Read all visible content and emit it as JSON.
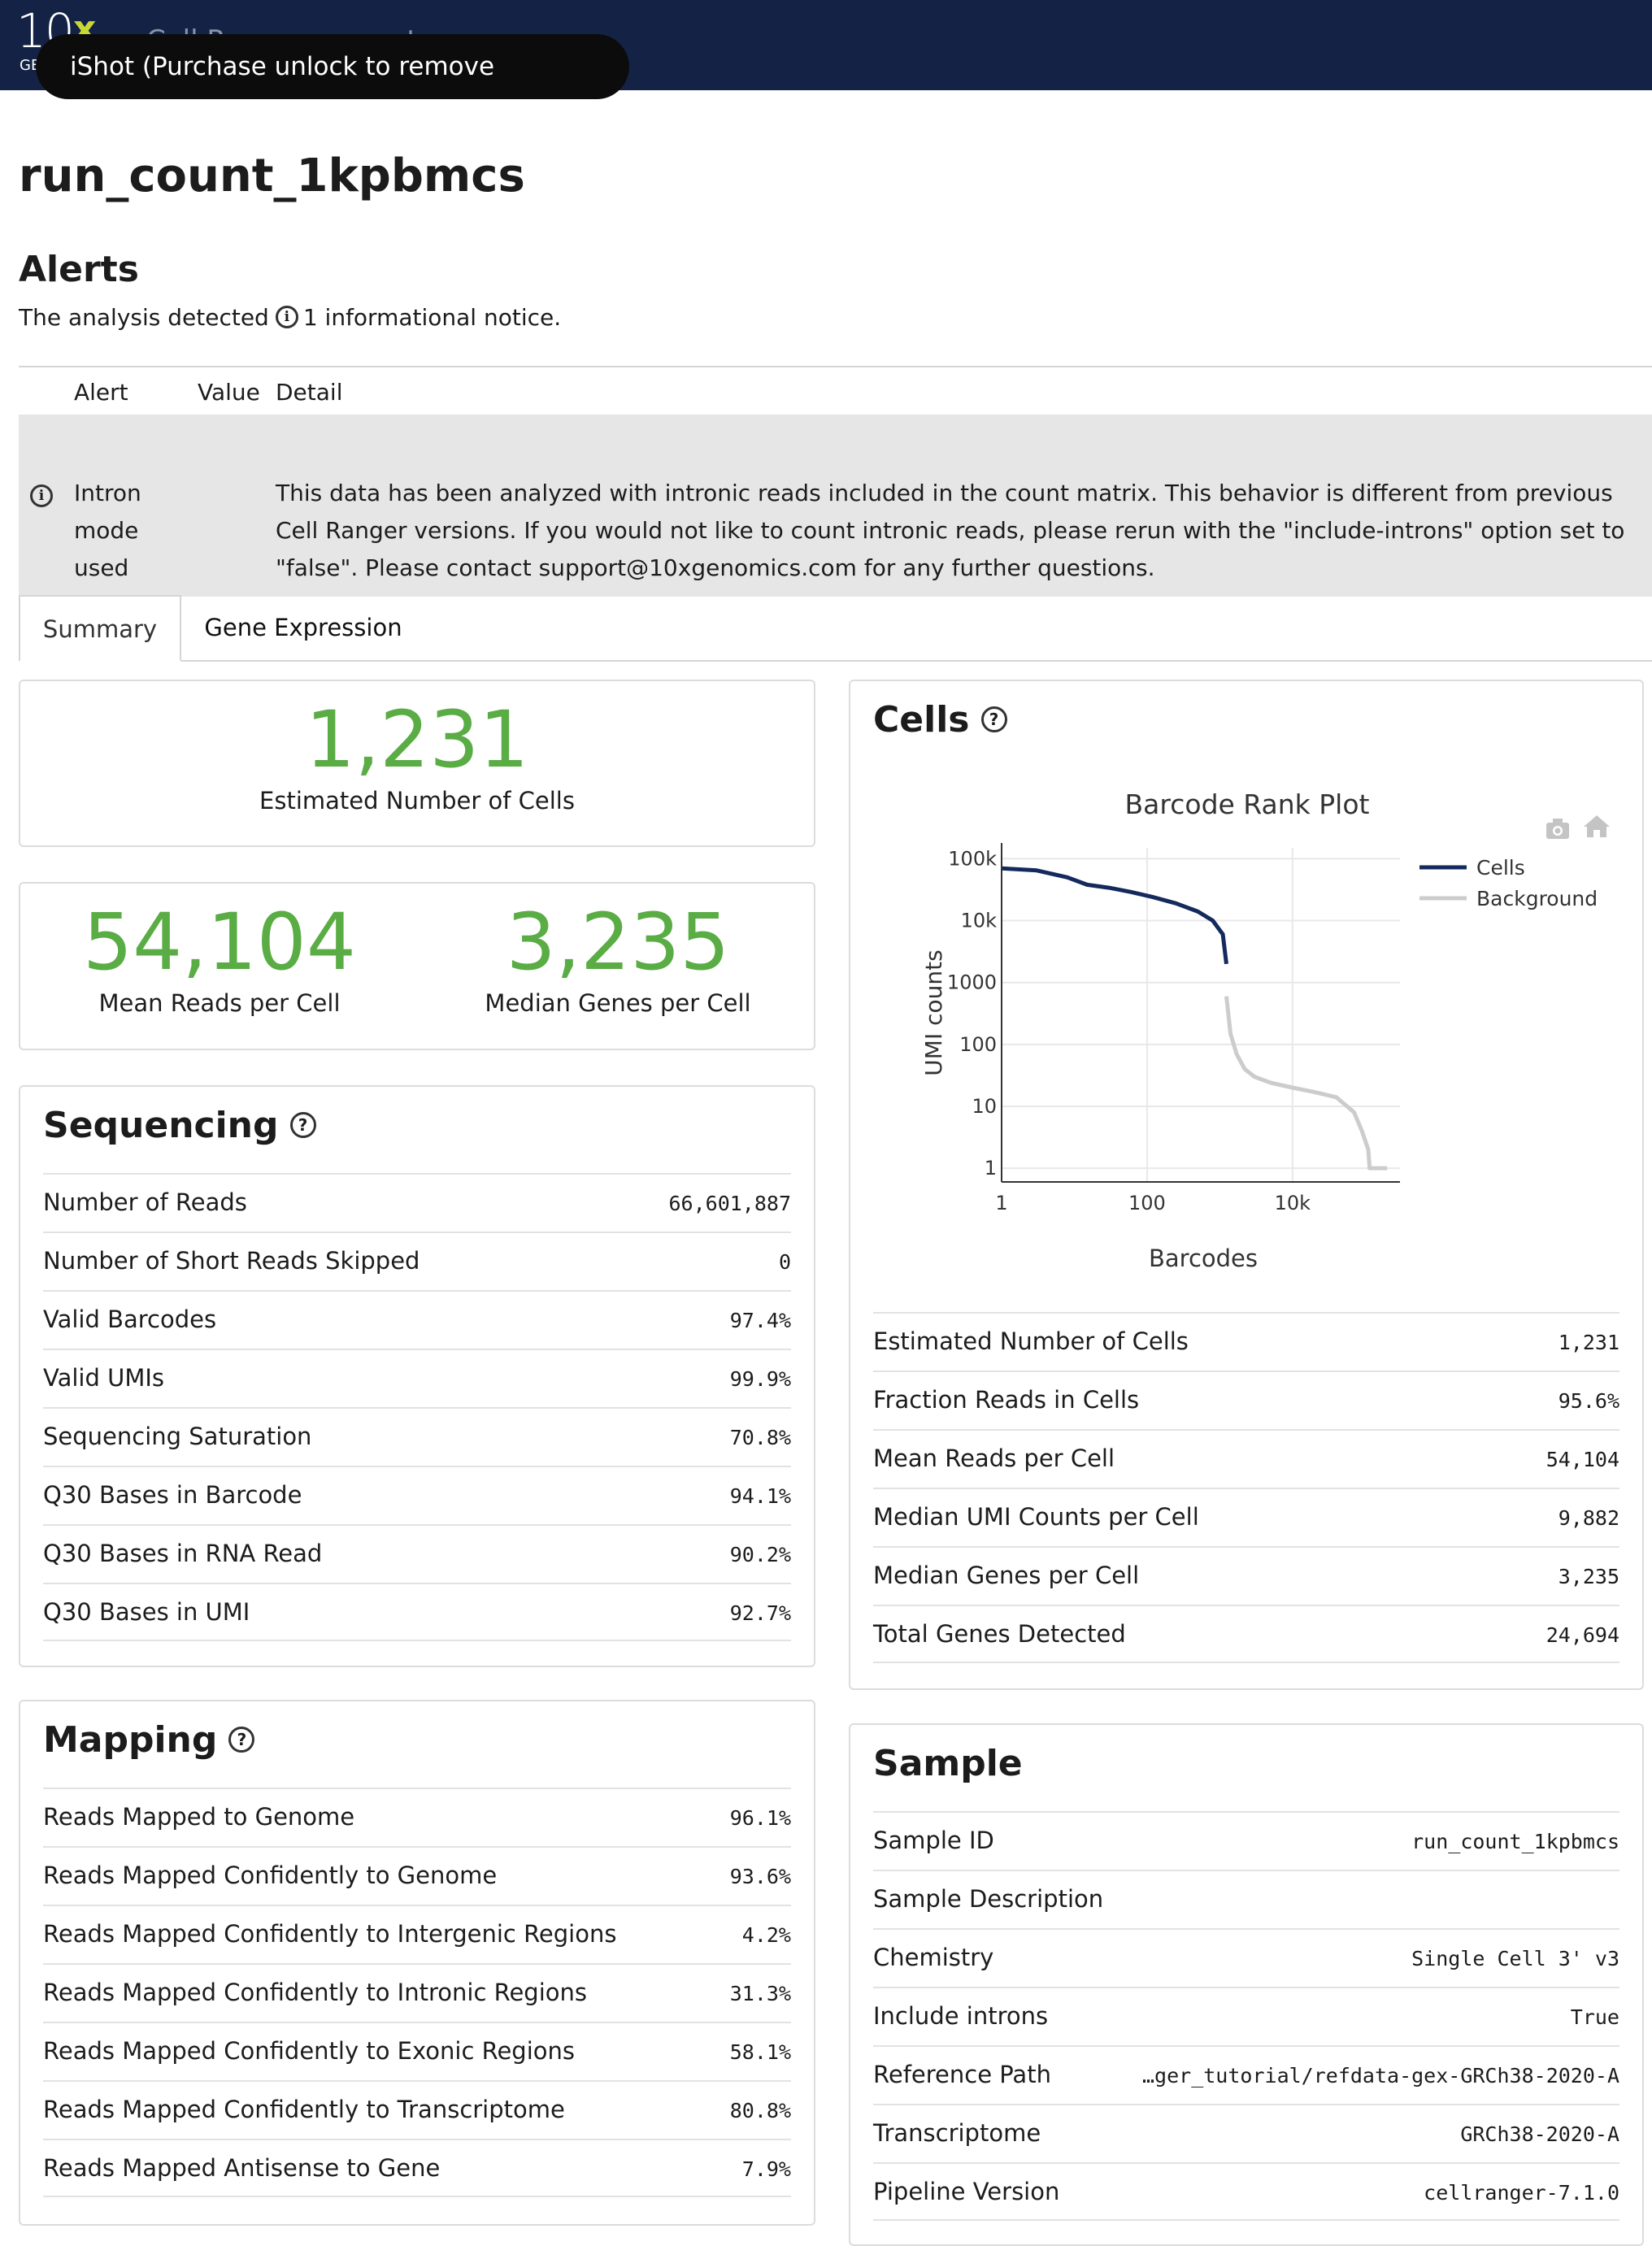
{
  "header": {
    "logo_main": "10",
    "logo_x": "x",
    "logo_sub": "GE",
    "app_title": "Cell Ranger • count",
    "watermark": "iShot (Purchase unlock to remove watermark)"
  },
  "run_title": "run_count_1kpbmcs",
  "alerts": {
    "heading": "Alerts",
    "summary_prefix": "The analysis detected",
    "summary_suffix": "1 informational notice.",
    "columns": [
      "Alert",
      "Value",
      "Detail"
    ],
    "rows": [
      {
        "icon": "info-icon",
        "alert": "Intron mode used",
        "value": "",
        "detail": "This data has been analyzed with intronic reads included in the count matrix. This behavior is different from previous Cell Ranger versions. If you would not like to count intronic reads, please rerun with the \"include-introns\" option set to \"false\". Please contact support@10xgenomics.com for any further questions."
      }
    ]
  },
  "tabs": [
    {
      "label": "Summary",
      "active": true
    },
    {
      "label": "Gene Expression",
      "active": false
    }
  ],
  "hero": {
    "cells_value": "1,231",
    "cells_label": "Estimated Number of Cells",
    "mean_reads_value": "54,104",
    "mean_reads_label": "Mean Reads per Cell",
    "median_genes_value": "3,235",
    "median_genes_label": "Median Genes per Cell",
    "accent_color": "#5aac44"
  },
  "sequencing": {
    "heading": "Sequencing",
    "rows": [
      {
        "label": "Number of Reads",
        "value": "66,601,887"
      },
      {
        "label": "Number of Short Reads Skipped",
        "value": "0"
      },
      {
        "label": "Valid Barcodes",
        "value": "97.4%"
      },
      {
        "label": "Valid UMIs",
        "value": "99.9%"
      },
      {
        "label": "Sequencing Saturation",
        "value": "70.8%"
      },
      {
        "label": "Q30 Bases in Barcode",
        "value": "94.1%"
      },
      {
        "label": "Q30 Bases in RNA Read",
        "value": "90.2%"
      },
      {
        "label": "Q30 Bases in UMI",
        "value": "92.7%"
      }
    ]
  },
  "mapping": {
    "heading": "Mapping",
    "rows": [
      {
        "label": "Reads Mapped to Genome",
        "value": "96.1%"
      },
      {
        "label": "Reads Mapped Confidently to Genome",
        "value": "93.6%"
      },
      {
        "label": "Reads Mapped Confidently to Intergenic Regions",
        "value": "4.2%"
      },
      {
        "label": "Reads Mapped Confidently to Intronic Regions",
        "value": "31.3%"
      },
      {
        "label": "Reads Mapped Confidently to Exonic Regions",
        "value": "58.1%"
      },
      {
        "label": "Reads Mapped Confidently to Transcriptome",
        "value": "80.8%"
      },
      {
        "label": "Reads Mapped Antisense to Gene",
        "value": "7.9%"
      }
    ]
  },
  "cells": {
    "heading": "Cells",
    "rows": [
      {
        "label": "Estimated Number of Cells",
        "value": "1,231"
      },
      {
        "label": "Fraction Reads in Cells",
        "value": "95.6%"
      },
      {
        "label": "Mean Reads per Cell",
        "value": "54,104"
      },
      {
        "label": "Median UMI Counts per Cell",
        "value": "9,882"
      },
      {
        "label": "Median Genes per Cell",
        "value": "3,235"
      },
      {
        "label": "Total Genes Detected",
        "value": "24,694"
      }
    ]
  },
  "sample": {
    "heading": "Sample",
    "rows": [
      {
        "label": "Sample ID",
        "value": "run_count_1kpbmcs"
      },
      {
        "label": "Sample Description",
        "value": ""
      },
      {
        "label": "Chemistry",
        "value": "Single Cell 3' v3"
      },
      {
        "label": "Include introns",
        "value": "True"
      },
      {
        "label": "Reference Path",
        "value": "…ger_tutorial/refdata-gex-GRCh38-2020-A"
      },
      {
        "label": "Transcriptome",
        "value": "GRCh38-2020-A"
      },
      {
        "label": "Pipeline Version",
        "value": "cellranger-7.1.0"
      }
    ]
  },
  "chart_data": {
    "type": "line",
    "title": "Barcode Rank Plot",
    "xlabel": "Barcodes",
    "ylabel": "UMI counts",
    "x_scale": "log",
    "y_scale": "log",
    "xlim": [
      1,
      300000
    ],
    "ylim": [
      0.6,
      150000
    ],
    "x_ticks": [
      {
        "value": 1,
        "label": "1"
      },
      {
        "value": 100,
        "label": "100"
      },
      {
        "value": 10000,
        "label": "10k"
      }
    ],
    "y_ticks": [
      {
        "value": 1,
        "label": "1"
      },
      {
        "value": 10,
        "label": "10"
      },
      {
        "value": 100,
        "label": "100"
      },
      {
        "value": 1000,
        "label": "1000"
      },
      {
        "value": 10000,
        "label": "10k"
      },
      {
        "value": 100000,
        "label": "100k"
      }
    ],
    "grid": true,
    "legend_position": "top-right",
    "series": [
      {
        "name": "Cells",
        "color": "#142a5c",
        "x": [
          1,
          3,
          8,
          15,
          30,
          60,
          120,
          250,
          500,
          800,
          1100,
          1231
        ],
        "y": [
          70000,
          65000,
          50000,
          38000,
          34000,
          29000,
          24000,
          19000,
          14000,
          10000,
          6000,
          2000
        ]
      },
      {
        "name": "Background",
        "color": "#cccccc",
        "x": [
          1231,
          1400,
          1700,
          2200,
          3000,
          5000,
          10000,
          20000,
          40000,
          70000,
          90000,
          110000,
          115000,
          200000
        ],
        "y": [
          600,
          150,
          70,
          40,
          30,
          24,
          20,
          17,
          14,
          8,
          4,
          2,
          1,
          1
        ]
      }
    ]
  }
}
